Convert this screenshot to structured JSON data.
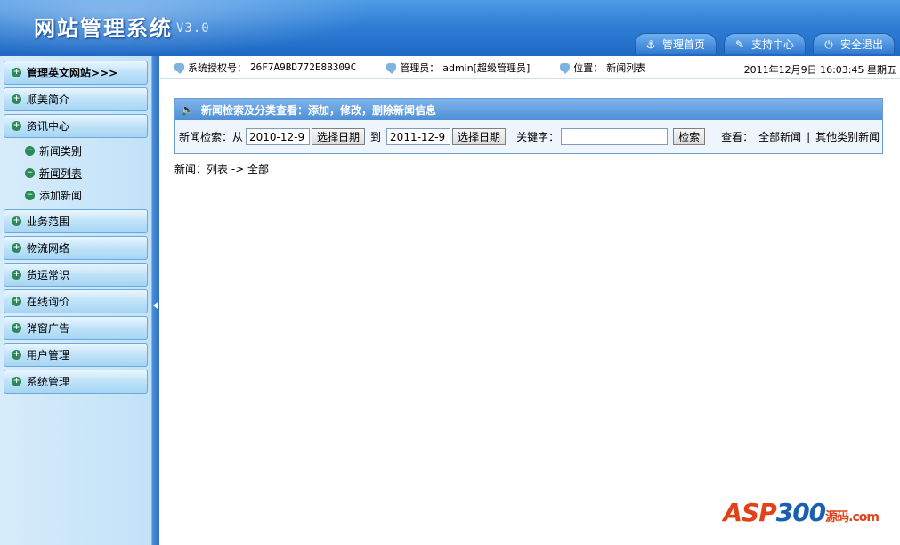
{
  "header": {
    "title": "网站管理系统",
    "version": "V3.0",
    "nav": [
      {
        "label": "管理首页",
        "icon": "anchor-icon"
      },
      {
        "label": "支持中心",
        "icon": "support-icon"
      },
      {
        "label": "安全退出",
        "icon": "exit-icon"
      }
    ]
  },
  "sidebar": {
    "items": [
      {
        "label": "管理英文网站>>>"
      },
      {
        "label": "顺美简介"
      },
      {
        "label": "资讯中心"
      },
      {
        "label": "业务范围"
      },
      {
        "label": "物流网络"
      },
      {
        "label": "货运常识"
      },
      {
        "label": "在线询价"
      },
      {
        "label": "弹窗广告"
      },
      {
        "label": "用户管理"
      },
      {
        "label": "系统管理"
      }
    ],
    "subitems": [
      {
        "label": "新闻类别"
      },
      {
        "label": "新闻列表"
      },
      {
        "label": "添加新闻"
      }
    ]
  },
  "infobar": {
    "license_label": "系统授权号：",
    "license_value": "26F7A9BD772E8B309C",
    "admin_label": "管理员：",
    "admin_value": "admin[超级管理员]",
    "location_label": "位置：",
    "location_value": "新闻列表",
    "datetime": "2011年12月9日 16:03:45 星期五"
  },
  "panel": {
    "title": "新闻检索及分类查看：添加，修改，删除新闻信息",
    "search_label": "新闻检索：从",
    "from_date": "2010-12-9",
    "pick_date_label": "选择日期",
    "to_label": "到",
    "to_date": "2011-12-9",
    "keyword_label": "关键字：",
    "keyword_value": "",
    "search_button": "检索",
    "view_label": "查看：",
    "view_all": "全部新闻",
    "separator": "|",
    "view_other": "其他类别新闻"
  },
  "breadcrumb": "新闻：列表 -> 全部",
  "watermark": {
    "brand": "ASP",
    "num": "300",
    "sub": "源码",
    "domain": ".com"
  }
}
